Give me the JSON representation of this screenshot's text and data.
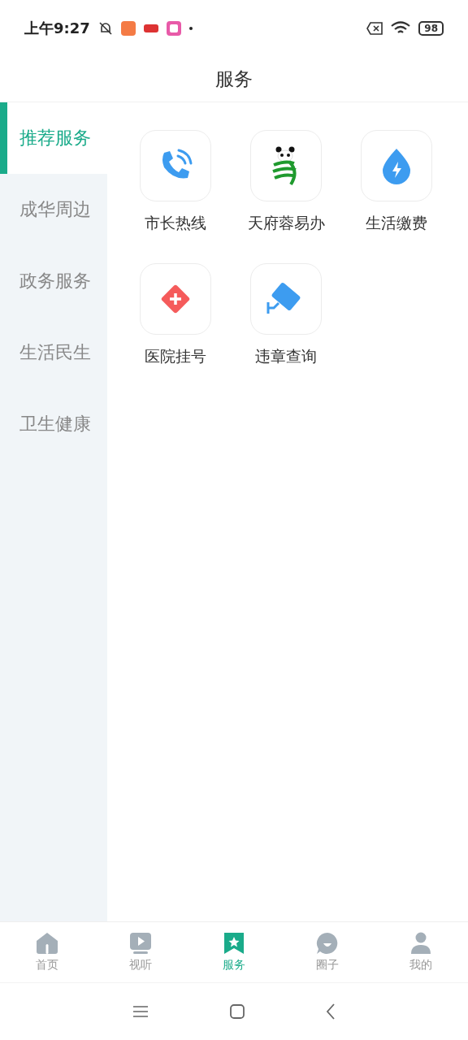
{
  "status_bar": {
    "time": "上午9:27",
    "battery": "98"
  },
  "header": {
    "title": "服务"
  },
  "sidebar": {
    "items": [
      {
        "label": "推荐服务",
        "selected": true
      },
      {
        "label": "成华周边",
        "selected": false
      },
      {
        "label": "政务服务",
        "selected": false
      },
      {
        "label": "生活民生",
        "selected": false
      },
      {
        "label": "卫生健康",
        "selected": false
      }
    ]
  },
  "services": [
    {
      "label": "市长热线",
      "kind": "phone"
    },
    {
      "label": "天府蓉易办",
      "kind": "panda"
    },
    {
      "label": "生活缴费",
      "kind": "drop"
    },
    {
      "label": "医院挂号",
      "kind": "hospital"
    },
    {
      "label": "违章查询",
      "kind": "camera"
    }
  ],
  "tab_bar": [
    {
      "label": "首页",
      "kind": "home",
      "selected": false
    },
    {
      "label": "视听",
      "kind": "video",
      "selected": false
    },
    {
      "label": "服务",
      "kind": "bookmark",
      "selected": true
    },
    {
      "label": "圈子",
      "kind": "chat",
      "selected": false
    },
    {
      "label": "我的",
      "kind": "person",
      "selected": false
    }
  ]
}
